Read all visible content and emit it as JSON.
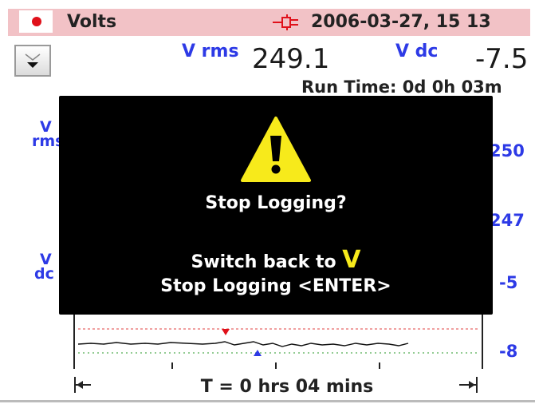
{
  "title_bar": {
    "mode": "Volts",
    "datetime": "2006-03-27, 15 13",
    "record_icon": "record-dot-icon",
    "connection_icon": "plug-icon"
  },
  "readouts": {
    "vrms_label": "V rms",
    "vrms_value": "249.1",
    "vdc_label": "V dc",
    "vdc_value": "-7.5",
    "run_time": "Run Time:  0d  0h 03m"
  },
  "trend": {
    "vrms_axis_label_1": "V",
    "vrms_axis_label_2": "rms",
    "vdc_axis_label_1": "V",
    "vdc_axis_label_2": "dc",
    "vrms_max": "250",
    "vrms_min": "247",
    "vdc_max": "-5",
    "vdc_min": "-8",
    "time_span": "T =  0 hrs 04 mins"
  },
  "dialog": {
    "title": "Stop Logging?",
    "line1_text": "Switch back to",
    "line1_symbol": "V",
    "line2": "Stop Logging  <ENTER>",
    "icon": "warning-icon"
  },
  "colors": {
    "title_bar": "#f2c2c6",
    "label_blue": "#2d3ae6",
    "warning_yellow": "#f7ea1b",
    "max_marker": "#e0101a",
    "min_marker": "#2d3ae6"
  }
}
